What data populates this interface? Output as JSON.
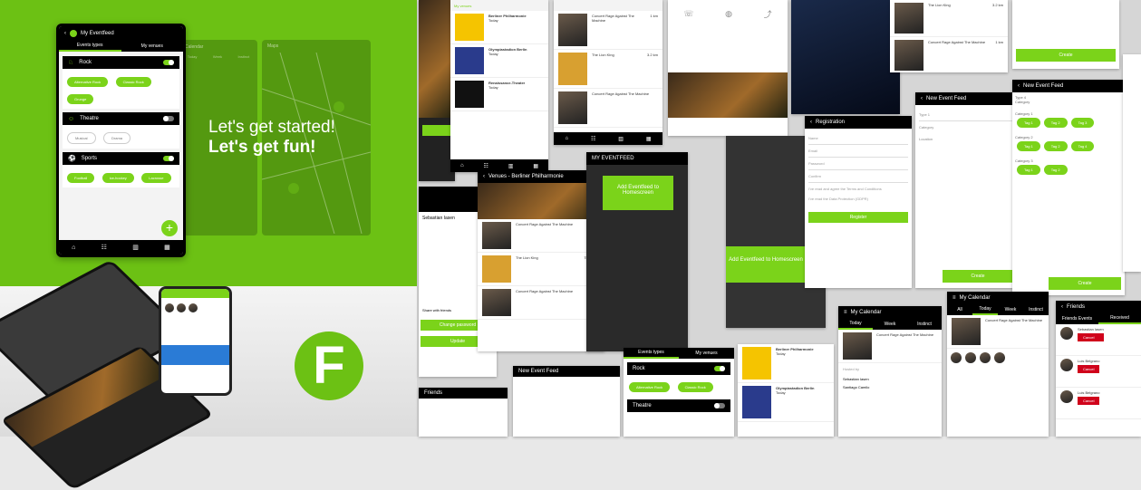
{
  "hero": {
    "line1": "Let's get started!",
    "line2": "Let's get fun!"
  },
  "main_phone": {
    "title": "My Eventfeed",
    "tabs": [
      "Events types",
      "My venues"
    ],
    "categories": [
      {
        "name": "Rock",
        "on": true,
        "pills": [
          "Alternative Rock",
          "Classic Rock",
          "Grunge"
        ]
      },
      {
        "name": "Theatre",
        "on": false,
        "pills": [
          "Musical",
          "Drama"
        ]
      },
      {
        "name": "Sports",
        "on": true,
        "pills": [
          "Football",
          "ice-hockey",
          "Lacrosse"
        ]
      }
    ],
    "fab": "+"
  },
  "calendar_ghost": {
    "title": "Calendar",
    "tabs": [
      "Today",
      "Week",
      "Instinct"
    ]
  },
  "map_ghost": {
    "title": "Maps"
  },
  "venues": [
    {
      "name": "Berliner Philharmonie",
      "sub": "Today"
    },
    {
      "name": "Olympiastadion Berlin",
      "sub": "Today"
    },
    {
      "name": "Renaissance-Theater",
      "sub": "Today"
    }
  ],
  "events": [
    {
      "name": "Concert Rage Against The Machine",
      "when": "Today",
      "dist": "1 km"
    },
    {
      "name": "The Lion King",
      "when": "Tomorrow",
      "dist": "3.2 km"
    },
    {
      "name": "Concert Rage Against The Machine",
      "when": "Today",
      "dist": "1 km"
    }
  ],
  "venue_header": "Venues - Berliner Philharmonie",
  "tooltips": {
    "one": "Add Eventfeed to Homescreen",
    "two": "Add Eventfeed to Homescreen"
  },
  "feed_title": "MY EVENTFEED",
  "registration": {
    "title": "Registration",
    "fields": [
      "Name",
      "Email",
      "Password",
      "Confirm"
    ],
    "checks": [
      "I've read and agree the Terms and Conditions",
      "I've read the Data Protection (GDPR)"
    ],
    "button": "Register"
  },
  "new_event": {
    "title": "New Event Feed",
    "fields": [
      "Type 1",
      "Category",
      "Location"
    ],
    "button": "Create"
  },
  "new_event2": {
    "title": "New Event Feed",
    "type": "Type 4",
    "category": "Category",
    "groups": [
      "Category 1",
      "Category 2",
      "Category 3"
    ],
    "tags": [
      "Tag 1",
      "Tag 2",
      "Tag 3",
      "Tag 4"
    ],
    "button": "Create"
  },
  "calendar": {
    "title": "My Calendar",
    "tabs": [
      "Today",
      "Week",
      "Instinct"
    ],
    "event": "Concert Rage Against The Machine",
    "hosted": "Hosted by",
    "people": [
      "Sebastian Iasen",
      "Santiago Camilo"
    ]
  },
  "calendar2": {
    "title": "My Calendar",
    "tabs": [
      "All",
      "Today",
      "Week",
      "Instinct"
    ]
  },
  "friends": {
    "title": "Friends",
    "tabs": [
      "Friends Events",
      "Received"
    ],
    "people": [
      "Sebastian Iasen",
      "Luis Belgrano",
      "Luis Belgrano"
    ],
    "cancel": "Cancel"
  },
  "profile": {
    "name": "Sebastian Iasen",
    "change_pw": "Change password",
    "update": "Update",
    "friends_label": "Share with friends"
  },
  "create_top": "Create",
  "bottom_new_event": "New Event Feed",
  "bottom_friends": "Friends",
  "rock_label": "Rock",
  "theatre_label": "Theatre",
  "my_venues": "My venues",
  "events_types": "Events types",
  "logo_letter": "F",
  "colors": {
    "brand": "#6cc114",
    "accent": "#7bd31a",
    "dark": "#000000",
    "cancel": "#d0021b"
  }
}
